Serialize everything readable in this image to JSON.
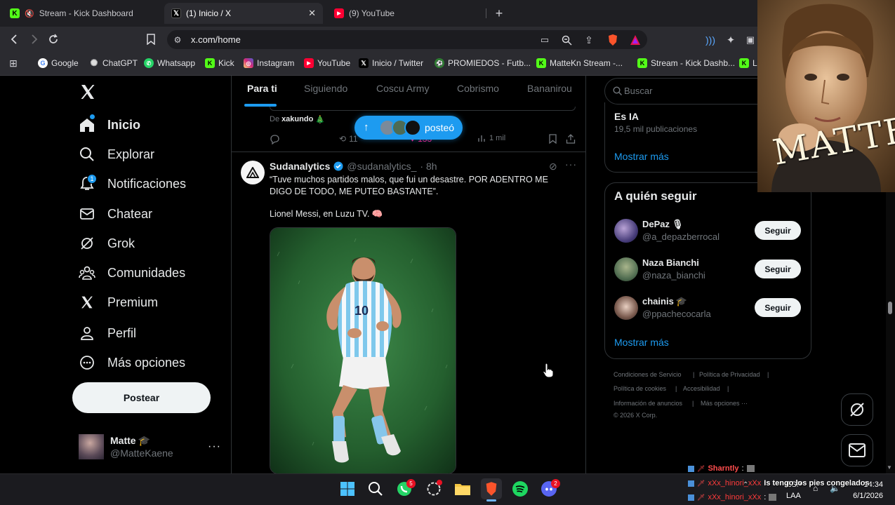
{
  "browser": {
    "tabs": [
      {
        "label": "Stream - Kick Dashboard"
      },
      {
        "label": "(1) Inicio / X"
      },
      {
        "label": "(9) YouTube"
      }
    ],
    "url": "x.com/home",
    "bookmarks": [
      {
        "label": "Google"
      },
      {
        "label": "ChatGPT"
      },
      {
        "label": "Whatsapp"
      },
      {
        "label": "Kick"
      },
      {
        "label": "Instagram"
      },
      {
        "label": "YouTube"
      },
      {
        "label": "Inicio / Twitter"
      },
      {
        "label": "PROMIEDOS - Futb..."
      },
      {
        "label": "MatteKn Stream -..."
      },
      {
        "label": "Stream - Kick Dashb..."
      },
      {
        "label": "L"
      }
    ]
  },
  "nav": {
    "items": [
      {
        "label": "Inicio"
      },
      {
        "label": "Explorar"
      },
      {
        "label": "Notificaciones",
        "badge": "1"
      },
      {
        "label": "Chatear"
      },
      {
        "label": "Grok"
      },
      {
        "label": "Comunidades"
      },
      {
        "label": "Premium"
      },
      {
        "label": "Perfil"
      },
      {
        "label": "Más opciones"
      }
    ],
    "post_button": "Postear",
    "account": {
      "name": "Matte",
      "emoji": "🎓",
      "handle": "@MatteKaene"
    }
  },
  "feed": {
    "tabs": [
      "Para ti",
      "Siguiendo",
      "Coscu Army",
      "Cobrismo",
      "Bananirou"
    ],
    "prev_post": {
      "from_prefix": "De",
      "from_user": "xakundo",
      "from_emoji": "🎄",
      "retweets": "11",
      "likes": "133",
      "views": "1 mil"
    },
    "new_posts_pill": {
      "label": "posteó"
    },
    "post": {
      "name": "Sudanalytics",
      "handle": "@sudanalytics_",
      "time": "· 8h",
      "text1": "“Tuve muchos partidos malos, que fui un desastre. POR ADENTRO ME DIGO DE TODO, ME PUTEO BASTANTE”.",
      "text2": "Lionel Messi, en Luzu TV. 🧠"
    }
  },
  "right": {
    "search_placeholder": "Buscar",
    "trend": {
      "title": "Es IA",
      "count": "19,5 mil publicaciones"
    },
    "show_more_1": "Mostrar más",
    "who_to_follow_title": "A quién seguir",
    "suggestions": [
      {
        "name": "DePaz",
        "emoji": "🎙",
        "handle": "@a_depazberrocal",
        "button": "Seguir"
      },
      {
        "name": "Naza Bianchi",
        "emoji": "",
        "handle": "@naza_bianchi",
        "button": "Seguir"
      },
      {
        "name": "chainis",
        "emoji": "🎓",
        "handle": "@ppachecocarla",
        "button": "Seguir"
      }
    ],
    "show_more_2": "Mostrar más",
    "footer": {
      "terms": "Condiciones de Servicio",
      "privacy": "Política de Privacidad",
      "cookies": "Política de cookies",
      "accessibility": "Accesibilidad",
      "ads": "Información de anuncios",
      "more": "Más opciones ···",
      "copyright": "© 2026 X Corp."
    }
  },
  "overlay": {
    "webcam_text": "MATTE"
  },
  "chat": [
    {
      "user": "Sharntly",
      "msg": ""
    },
    {
      "user": "xXx_hinori_xXx",
      "msg": "Is tengo los pies congelados"
    },
    {
      "user": "xXx_hinori_xXx",
      "msg": ""
    }
  ],
  "taskbar": {
    "whatsapp_badge": "5",
    "discord_badge": "2",
    "lang": "ESP",
    "lang2": "LAA",
    "time": "14:34",
    "date": "6/1/2026"
  },
  "colors": {
    "accent": "#1d9bf0",
    "background": "#000000",
    "border": "#2f3336"
  }
}
